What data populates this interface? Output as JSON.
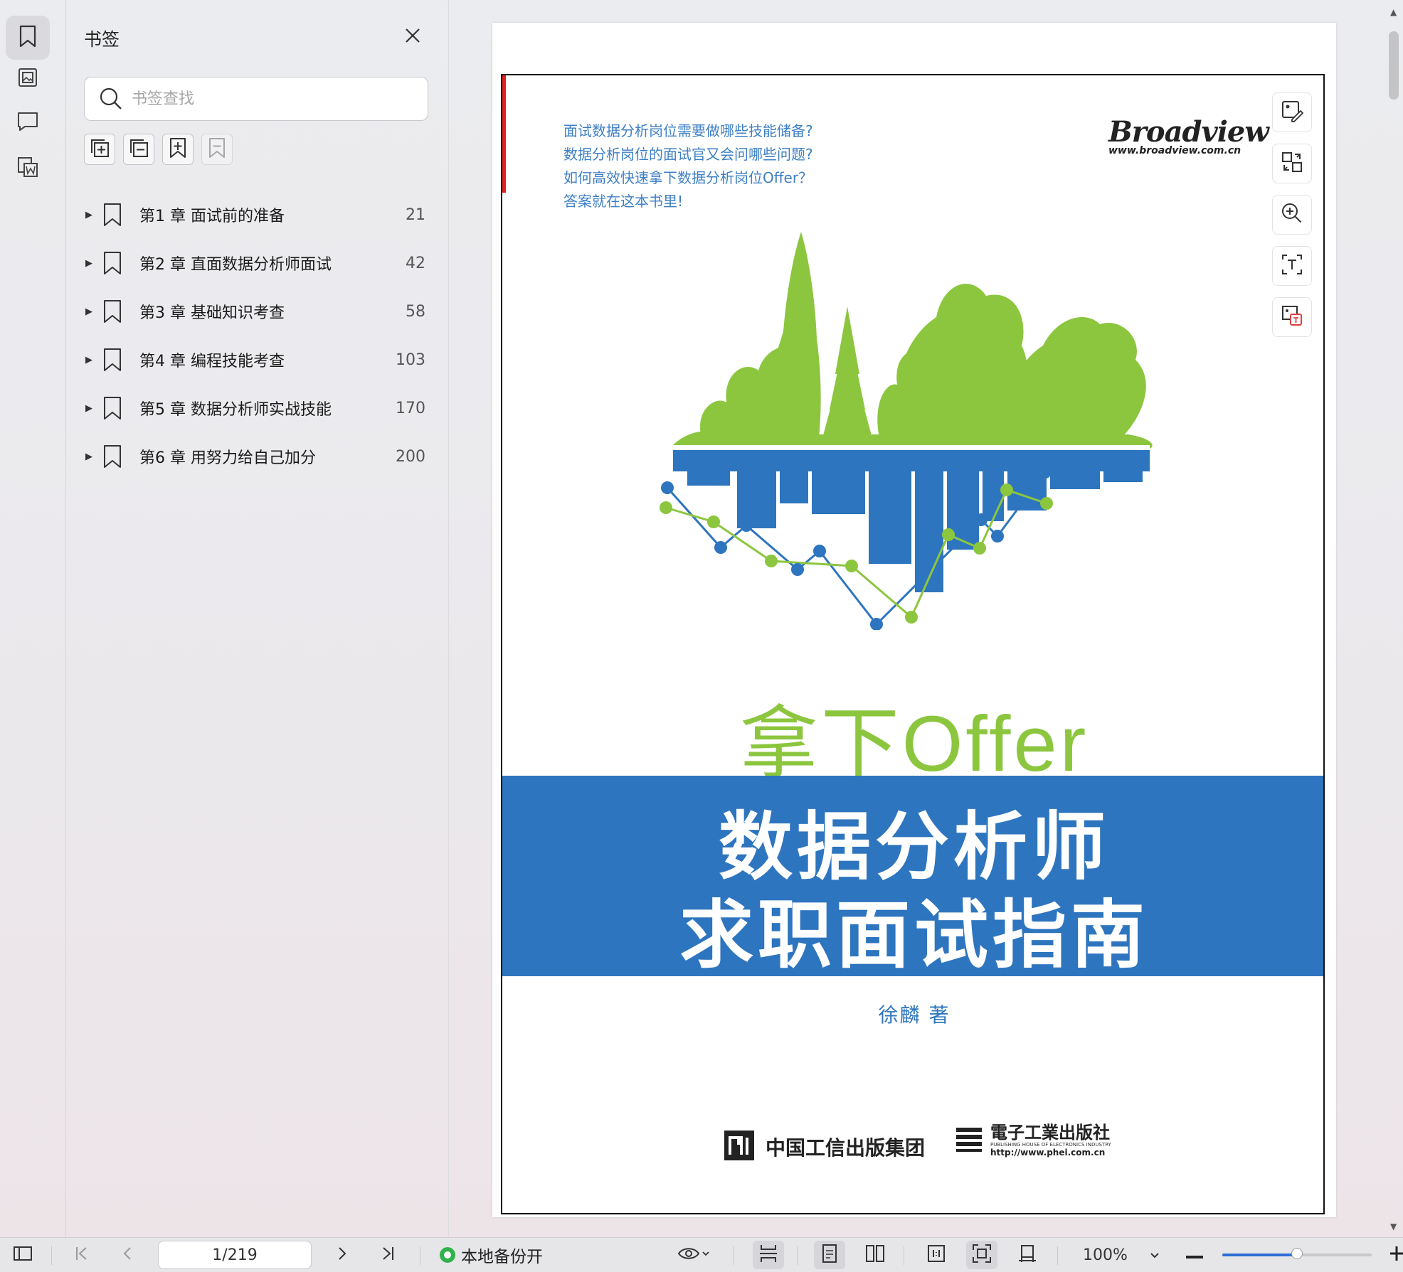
{
  "sidebar_rail": {
    "items": [
      {
        "icon": "bookmark-icon",
        "active": true
      },
      {
        "icon": "thumbnail-icon",
        "active": false
      },
      {
        "icon": "comment-icon",
        "active": false
      },
      {
        "icon": "convert-word-icon",
        "active": false
      }
    ]
  },
  "bookmark_panel": {
    "title": "书签",
    "search_placeholder": "书签查找",
    "bookmarks": [
      {
        "label": "第1 章  面试前的准备",
        "page": "21"
      },
      {
        "label": "第2 章  直面数据分析师面试",
        "page": "42"
      },
      {
        "label": "第3 章  基础知识考查",
        "page": "58"
      },
      {
        "label": "第4 章  编程技能考查",
        "page": "103"
      },
      {
        "label": "第5 章  数据分析师实战技能",
        "page": "170"
      },
      {
        "label": "第6 章  用努力给自己加分",
        "page": "200"
      }
    ]
  },
  "cover": {
    "questions": [
      "面试数据分析岗位需要做哪些技能储备?",
      "数据分析岗位的面试官又会问哪些问题?",
      "如何高效快速拿下数据分析岗位Offer？",
      "答案就在这本书里!"
    ],
    "brand": "Broadview",
    "brand_url": "www.broadview.com.cn",
    "headline": "拿下Offer",
    "title_line1": "数据分析师",
    "title_line2": "求职面试指南",
    "author": "徐麟    著",
    "publisher1": "中国工信出版集团",
    "publisher2": "電子工業出版社",
    "publisher2_sub": "PUBLISHING HOUSE OF ELECTRONICS INDUSTRY",
    "publisher2_url": "http://www.phei.com.cn",
    "colors": {
      "green": "#8cc63f",
      "blue": "#2e75bf",
      "red": "#e02020"
    }
  },
  "side_tools": [
    "image-edit-icon",
    "convert-icon",
    "zoom-in-icon",
    "ocr-text-icon",
    "image-translate-icon"
  ],
  "statusbar": {
    "page_indicator": "1/219",
    "backup_label": "本地备份开",
    "zoom": "100%",
    "zoom_slider_fraction": 0.5
  }
}
